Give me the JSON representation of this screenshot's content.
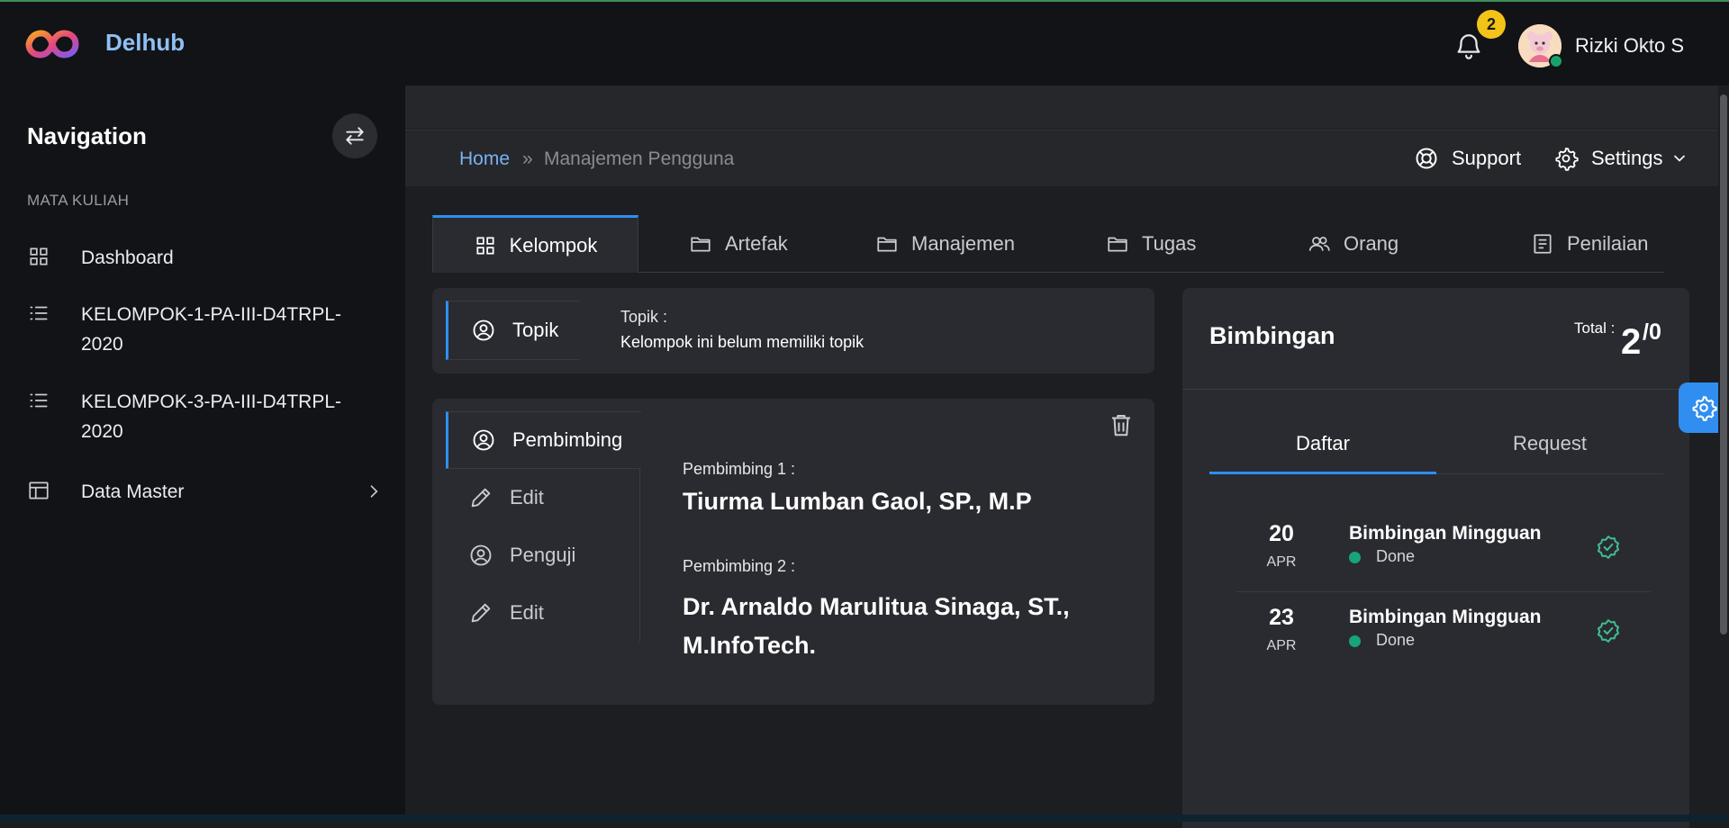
{
  "app": {
    "brand": "Delhub"
  },
  "header": {
    "notification_count": "2",
    "user_name": "Rizki Okto S"
  },
  "sidebar": {
    "title": "Navigation",
    "section_label": "MATA KULIAH",
    "items": [
      {
        "label": "Dashboard",
        "icon": "grid-icon"
      },
      {
        "label": "KELOMPOK-1-PA-III-D4TRPL-2020",
        "icon": "list-icon"
      },
      {
        "label": "KELOMPOK-3-PA-III-D4TRPL-2020",
        "icon": "list-icon"
      },
      {
        "label": "Data Master",
        "icon": "layout-icon"
      }
    ]
  },
  "breadcrumb": {
    "home": "Home",
    "separator": "»",
    "current": "Manajemen Pengguna"
  },
  "toolbar": {
    "support": "Support",
    "settings": "Settings"
  },
  "tabs": [
    {
      "label": "Kelompok",
      "icon": "grid-icon",
      "active": true
    },
    {
      "label": "Artefak",
      "icon": "folder-icon"
    },
    {
      "label": "Manajemen",
      "icon": "folder-icon"
    },
    {
      "label": "Tugas",
      "icon": "folder-icon"
    },
    {
      "label": "Orang",
      "icon": "users-icon"
    },
    {
      "label": "Penilaian",
      "icon": "document-icon"
    }
  ],
  "topik": {
    "tab_label": "Topik",
    "label": "Topik :",
    "value": "Kelompok ini belum memiliki topik"
  },
  "pembimbing": {
    "tabs": [
      {
        "label": "Pembimbing",
        "icon": "user-circle-icon",
        "active": true
      },
      {
        "label": "Edit",
        "icon": "pencil-icon"
      },
      {
        "label": "Penguji",
        "icon": "user-circle-icon"
      },
      {
        "label": "Edit",
        "icon": "pencil-icon"
      }
    ],
    "p1_label": "Pembimbing 1 :",
    "p1_name": "Tiurma Lumban Gaol, SP., M.P",
    "p2_label": "Pembimbing 2 :",
    "p2_name": "Dr. Arnaldo Marulitua Sinaga, ST., M.InfoTech."
  },
  "bimbingan": {
    "title": "Bimbingan",
    "total_label": "Total :",
    "total_value": "2",
    "total_suffix": "/0",
    "tabs": [
      {
        "label": "Daftar",
        "active": true
      },
      {
        "label": "Request"
      }
    ],
    "entries": [
      {
        "day": "20",
        "month": "APR",
        "title": "Bimbingan Mingguan",
        "status": "Done"
      },
      {
        "day": "23",
        "month": "APR",
        "title": "Bimbingan Mingguan",
        "status": "Done"
      }
    ]
  },
  "colors": {
    "accent": "#2f8ef0",
    "brand": "#8fc0f5",
    "badge": "#f2c318",
    "success": "#19a37a"
  }
}
